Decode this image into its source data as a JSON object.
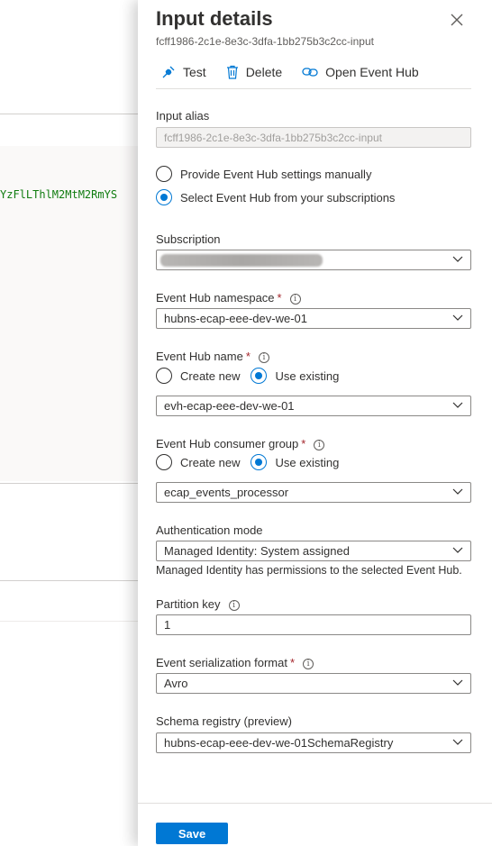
{
  "background": {
    "code_snippet": "YzFlLThlM2MtM2RmYS"
  },
  "panel": {
    "title": "Input details",
    "subtitle": "fcff1986-2c1e-8e3c-3dfa-1bb275b3c2cc-input",
    "toolbar": {
      "test_label": "Test",
      "delete_label": "Delete",
      "open_label": "Open Event Hub"
    },
    "input_alias": {
      "label": "Input alias",
      "value": "fcff1986-2c1e-8e3c-3dfa-1bb275b3c2cc-input"
    },
    "source_mode": {
      "manual_label": "Provide Event Hub settings manually",
      "subscription_label": "Select Event Hub from your subscriptions",
      "selected": "subscription"
    },
    "subscription": {
      "label": "Subscription"
    },
    "namespace": {
      "label": "Event Hub namespace",
      "value": "hubns-ecap-eee-dev-we-01"
    },
    "hub_name": {
      "label": "Event Hub name",
      "create_label": "Create new",
      "existing_label": "Use existing",
      "value": "evh-ecap-eee-dev-we-01"
    },
    "consumer_group": {
      "label": "Event Hub consumer group",
      "create_label": "Create new",
      "existing_label": "Use existing",
      "value": "ecap_events_processor"
    },
    "auth": {
      "label": "Authentication mode",
      "value": "Managed Identity: System assigned",
      "helper": "Managed Identity has permissions to the selected Event Hub."
    },
    "partition_key": {
      "label": "Partition key",
      "value": "1"
    },
    "serialization": {
      "label": "Event serialization format",
      "value": "Avro"
    },
    "schema_registry": {
      "label": "Schema registry (preview)",
      "value": "hubns-ecap-eee-dev-we-01SchemaRegistry"
    },
    "save_label": "Save"
  },
  "colors": {
    "accent": "#0078d4",
    "required": "#a4262c",
    "code_green": "#107c10"
  }
}
